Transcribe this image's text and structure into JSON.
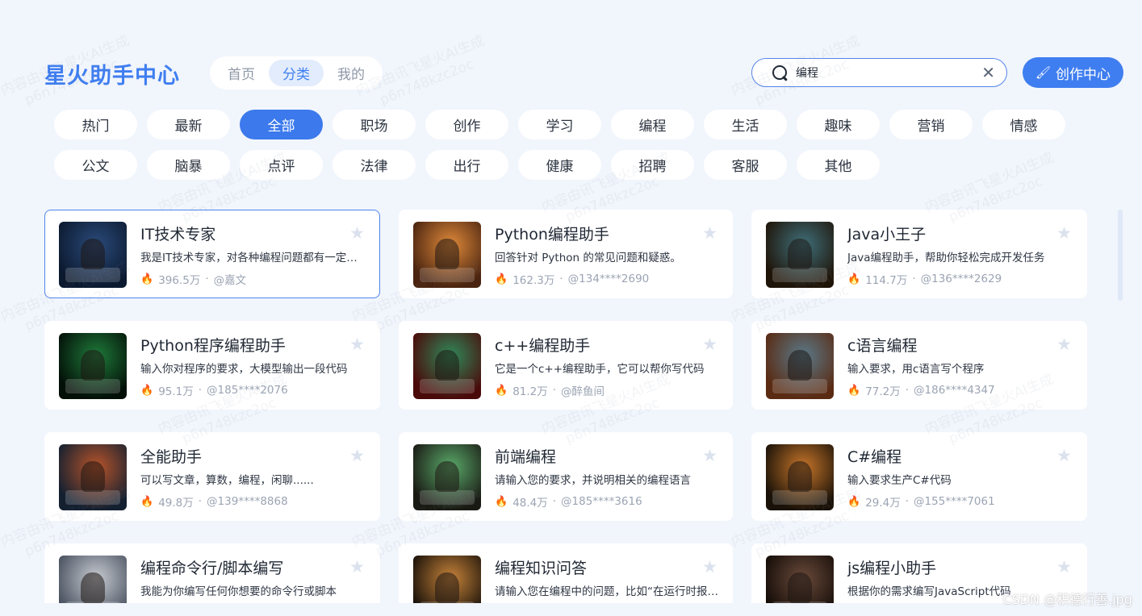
{
  "brand": "星火助手中心",
  "top_nav": [
    {
      "label": "首页",
      "active": false
    },
    {
      "label": "分类",
      "active": true
    },
    {
      "label": "我的",
      "active": false
    }
  ],
  "search": {
    "value": "编程",
    "placeholder": ""
  },
  "create_button": "创作中心",
  "categories": [
    {
      "label": "热门",
      "active": false
    },
    {
      "label": "最新",
      "active": false
    },
    {
      "label": "全部",
      "active": true
    },
    {
      "label": "职场",
      "active": false
    },
    {
      "label": "创作",
      "active": false
    },
    {
      "label": "学习",
      "active": false
    },
    {
      "label": "编程",
      "active": false
    },
    {
      "label": "生活",
      "active": false
    },
    {
      "label": "趣味",
      "active": false
    },
    {
      "label": "营销",
      "active": false
    },
    {
      "label": "情感",
      "active": false
    },
    {
      "label": "公文",
      "active": false
    },
    {
      "label": "脑暴",
      "active": false
    },
    {
      "label": "点评",
      "active": false
    },
    {
      "label": "法律",
      "active": false
    },
    {
      "label": "出行",
      "active": false
    },
    {
      "label": "健康",
      "active": false
    },
    {
      "label": "招聘",
      "active": false
    },
    {
      "label": "客服",
      "active": false
    },
    {
      "label": "其他",
      "active": false
    }
  ],
  "cards": [
    {
      "title": "IT技术专家",
      "desc": "我是IT技术专家，对各种编程问题都有一定的了解",
      "count": "396.5万",
      "author": "@嘉文",
      "selected": true,
      "thumb": [
        "#2a4a7a",
        "#0c1a30"
      ]
    },
    {
      "title": "Python编程助手",
      "desc": "回答针对 Python 的常见问题和疑惑。",
      "count": "162.3万",
      "author": "@134****2690",
      "selected": false,
      "thumb": [
        "#e08a3a",
        "#4a2410"
      ]
    },
    {
      "title": "Java小王子",
      "desc": "Java编程助手，帮助你轻松完成开发任务",
      "count": "114.7万",
      "author": "@136****2629",
      "selected": false,
      "thumb": [
        "#3f6f7a",
        "#1f1408"
      ]
    },
    {
      "title": "Python程序编程助手",
      "desc": "输入你对程序的要求，大模型输出一段代码",
      "count": "95.1万",
      "author": "@185****2076",
      "selected": false,
      "thumb": [
        "#1f7a3a",
        "#031008"
      ]
    },
    {
      "title": "c++编程助手",
      "desc": "它是一个c++编程助手，它可以帮你写代码",
      "count": "81.2万",
      "author": "@醉鱼间",
      "selected": false,
      "thumb": [
        "#2f8a5a",
        "#4a0a0a"
      ]
    },
    {
      "title": "c语言编程",
      "desc": "输入要求，用c语言写个程序",
      "count": "77.2万",
      "author": "@186****4347",
      "selected": false,
      "thumb": [
        "#5a7a8a",
        "#5a2a12"
      ]
    },
    {
      "title": "全能助手",
      "desc": "可以写文章，算数，编程，闲聊......",
      "count": "49.8万",
      "author": "@139****8868",
      "selected": false,
      "thumb": [
        "#b8542a",
        "#142030"
      ]
    },
    {
      "title": "前端编程",
      "desc": "请输入您的要求，并说明相关的编程语言",
      "count": "48.4万",
      "author": "@185****3616",
      "selected": false,
      "thumb": [
        "#5aaa6a",
        "#1a1a14"
      ]
    },
    {
      "title": "C#编程",
      "desc": "输入要求生产C#代码",
      "count": "29.4万",
      "author": "@155****7061",
      "selected": false,
      "thumb": [
        "#c8762a",
        "#1a1208"
      ]
    },
    {
      "title": "编程命令行/脚本编写",
      "desc": "我能为你编写任何你想要的命令行或脚本",
      "count": "",
      "author": "",
      "selected": false,
      "thumb": [
        "#c8ccd2",
        "#4a5260"
      ]
    },
    {
      "title": "编程知识问答",
      "desc": "请输入您在编程中的问题，比如“在运行时报错”",
      "count": "",
      "author": "",
      "selected": false,
      "thumb": [
        "#c8843a",
        "#1a120a"
      ]
    },
    {
      "title": "js编程小助手",
      "desc": "根据你的需求编写JavaScript代码",
      "count": "",
      "author": "",
      "selected": false,
      "thumb": [
        "#6a4a3a",
        "#140c08"
      ]
    }
  ],
  "watermark": [
    "内容由讯飞星火AI生成",
    "p6n748kzc2oc"
  ],
  "credit": "CSDN @积德行善.jpg"
}
